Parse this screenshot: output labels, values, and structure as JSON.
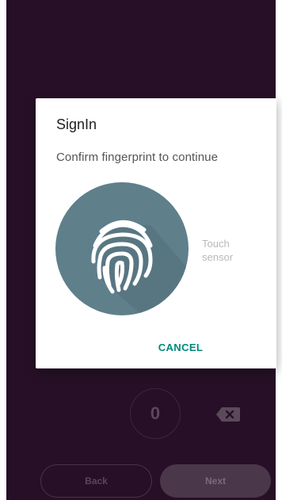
{
  "dialog": {
    "title": "SignIn",
    "subtitle": "Confirm fingerprint to continue",
    "sensor_label_line1": "Touch",
    "sensor_label_line2": "sensor",
    "cancel_label": "CANCEL"
  },
  "keypad": {
    "digit_0": "0",
    "backspace_icon": "backspace-icon"
  },
  "footer": {
    "back_label": "Back",
    "next_label": "Next"
  },
  "colors": {
    "screen_background": "#271027",
    "fingerprint_circle": "#5f7f8b",
    "cancel_accent": "#00897b"
  }
}
